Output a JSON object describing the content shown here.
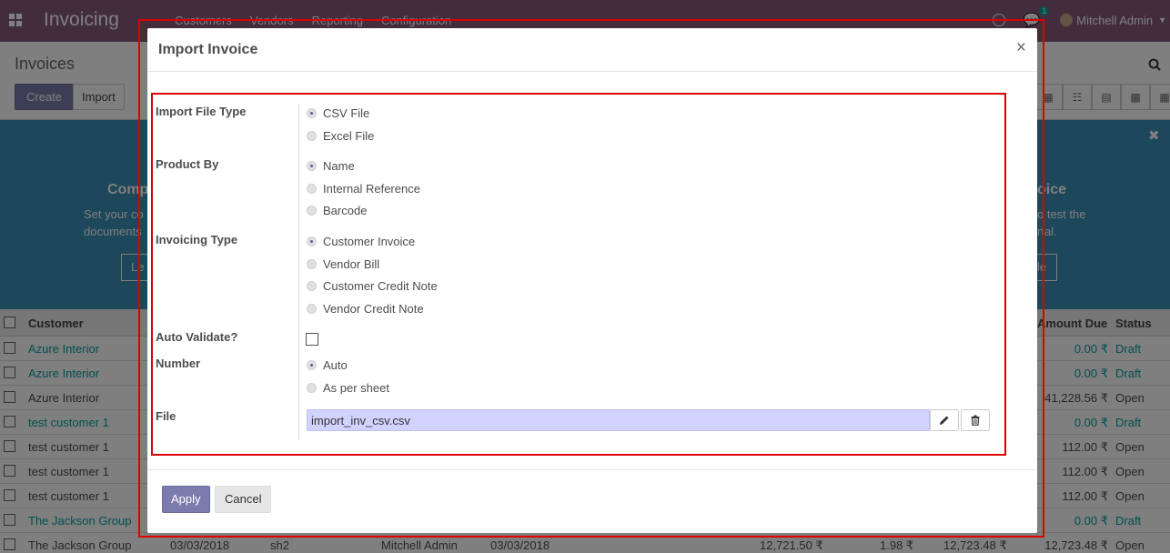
{
  "navbar": {
    "brand": "Invoicing",
    "menu": [
      "Customers",
      "Vendors",
      "Reporting",
      "Configuration"
    ],
    "chat_badge": "1",
    "user": "Mitchell Admin"
  },
  "control_panel": {
    "title": "Invoices",
    "create_label": "Create",
    "import_label": "Import"
  },
  "banner": {
    "left_title": "Comp",
    "left_sub_1": "Set your co",
    "left_sub_2": "documents",
    "left_btn": "Le",
    "right_title": "oice",
    "right_sub_1": "o test the",
    "right_sub_2": "rtal.",
    "right_btn": "le"
  },
  "list": {
    "headers": {
      "customer": "Customer",
      "amount_due": "Amount Due",
      "status": "Status"
    },
    "rows": [
      {
        "customer": "Azure Interior",
        "due": "0.00 ₹",
        "status": "Draft",
        "link": true
      },
      {
        "customer": "Azure Interior",
        "due": "0.00 ₹",
        "status": "Draft",
        "link": true
      },
      {
        "customer": "Azure Interior",
        "due": "41,228.56 ₹",
        "status": "Open",
        "link": false
      },
      {
        "customer": "test customer 1",
        "due": "0.00 ₹",
        "status": "Draft",
        "link": true
      },
      {
        "customer": "test customer 1",
        "due": "112.00 ₹",
        "status": "Open",
        "link": false
      },
      {
        "customer": "test customer 1",
        "due": "112.00 ₹",
        "status": "Open",
        "link": false
      },
      {
        "customer": "test customer 1",
        "due": "112.00 ₹",
        "status": "Open",
        "link": false
      },
      {
        "customer": "The Jackson Group",
        "due": "0.00 ₹",
        "status": "Draft",
        "link": true
      }
    ],
    "last_row": {
      "customer": "The Jackson Group",
      "date": "03/03/2018",
      "number": "sh2",
      "salesperson": "Mitchell Admin",
      "due_date": "03/03/2018",
      "untaxed": "12,721.50 ₹",
      "tax": "1.98 ₹",
      "total": "12,723.48 ₹",
      "due": "12,723.48 ₹",
      "status": "Open"
    }
  },
  "modal": {
    "title": "Import Invoice",
    "fields": {
      "import_file_type": {
        "label": "Import File Type",
        "options": [
          "CSV File",
          "Excel File"
        ],
        "selected": 0
      },
      "product_by": {
        "label": "Product By",
        "options": [
          "Name",
          "Internal Reference",
          "Barcode"
        ],
        "selected": 0
      },
      "invoicing_type": {
        "label": "Invoicing Type",
        "options": [
          "Customer Invoice",
          "Vendor Bill",
          "Customer Credit Note",
          "Vendor Credit Note"
        ],
        "selected": 0
      },
      "auto_validate": {
        "label": "Auto Validate?",
        "checked": false
      },
      "number": {
        "label": "Number",
        "options": [
          "Auto",
          "As per sheet"
        ],
        "selected": 0
      },
      "file": {
        "label": "File",
        "value": "import_inv_csv.csv"
      }
    },
    "apply_label": "Apply",
    "cancel_label": "Cancel"
  }
}
